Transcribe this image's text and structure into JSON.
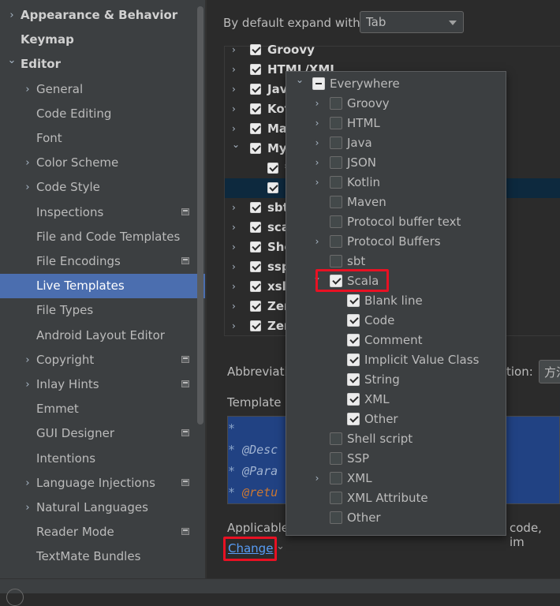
{
  "sidebar": {
    "items": [
      {
        "label": "Appearance & Behavior",
        "level": 0,
        "chevron": "right",
        "bold": true,
        "selected": false,
        "pin": false
      },
      {
        "label": "Keymap",
        "level": 0,
        "chevron": "",
        "bold": true,
        "selected": false,
        "pin": false
      },
      {
        "label": "Editor",
        "level": 0,
        "chevron": "down",
        "bold": true,
        "selected": false,
        "pin": false
      },
      {
        "label": "General",
        "level": 1,
        "chevron": "right",
        "bold": false,
        "selected": false,
        "pin": false
      },
      {
        "label": "Code Editing",
        "level": 1,
        "chevron": "",
        "bold": false,
        "selected": false,
        "pin": false
      },
      {
        "label": "Font",
        "level": 1,
        "chevron": "",
        "bold": false,
        "selected": false,
        "pin": false
      },
      {
        "label": "Color Scheme",
        "level": 1,
        "chevron": "right",
        "bold": false,
        "selected": false,
        "pin": false
      },
      {
        "label": "Code Style",
        "level": 1,
        "chevron": "right",
        "bold": false,
        "selected": false,
        "pin": false
      },
      {
        "label": "Inspections",
        "level": 1,
        "chevron": "",
        "bold": false,
        "selected": false,
        "pin": true
      },
      {
        "label": "File and Code Templates",
        "level": 1,
        "chevron": "",
        "bold": false,
        "selected": false,
        "pin": false
      },
      {
        "label": "File Encodings",
        "level": 1,
        "chevron": "",
        "bold": false,
        "selected": false,
        "pin": true
      },
      {
        "label": "Live Templates",
        "level": 1,
        "chevron": "",
        "bold": false,
        "selected": true,
        "pin": false
      },
      {
        "label": "File Types",
        "level": 1,
        "chevron": "",
        "bold": false,
        "selected": false,
        "pin": false
      },
      {
        "label": "Android Layout Editor",
        "level": 1,
        "chevron": "",
        "bold": false,
        "selected": false,
        "pin": false
      },
      {
        "label": "Copyright",
        "level": 1,
        "chevron": "right",
        "bold": false,
        "selected": false,
        "pin": true
      },
      {
        "label": "Inlay Hints",
        "level": 1,
        "chevron": "right",
        "bold": false,
        "selected": false,
        "pin": true
      },
      {
        "label": "Emmet",
        "level": 1,
        "chevron": "",
        "bold": false,
        "selected": false,
        "pin": false
      },
      {
        "label": "GUI Designer",
        "level": 1,
        "chevron": "",
        "bold": false,
        "selected": false,
        "pin": true
      },
      {
        "label": "Intentions",
        "level": 1,
        "chevron": "",
        "bold": false,
        "selected": false,
        "pin": false
      },
      {
        "label": "Language Injections",
        "level": 1,
        "chevron": "right",
        "bold": false,
        "selected": false,
        "pin": true
      },
      {
        "label": "Natural Languages",
        "level": 1,
        "chevron": "right",
        "bold": false,
        "selected": false,
        "pin": false
      },
      {
        "label": "Reader Mode",
        "level": 1,
        "chevron": "",
        "bold": false,
        "selected": false,
        "pin": true
      },
      {
        "label": "TextMate Bundles",
        "level": 1,
        "chevron": "",
        "bold": false,
        "selected": false,
        "pin": false
      }
    ]
  },
  "main": {
    "expand_label": "By default expand with",
    "expand_value": "Tab",
    "tree_rows": [
      {
        "label": "Groovy",
        "chevron": "right",
        "indent": 0,
        "selected": false
      },
      {
        "label": "HTML/XML",
        "chevron": "right",
        "indent": 0,
        "selected": false
      },
      {
        "label": "Java",
        "chevron": "right",
        "indent": 0,
        "selected": false
      },
      {
        "label": "Kotlin",
        "chevron": "right",
        "indent": 0,
        "selected": false
      },
      {
        "label": "Maven",
        "chevron": "right",
        "indent": 0,
        "selected": false
      },
      {
        "label": "My",
        "chevron": "down",
        "indent": 0,
        "selected": false
      },
      {
        "label": "*",
        "chevron": "",
        "indent": 1,
        "selected": false
      },
      {
        "label": "",
        "chevron": "",
        "indent": 1,
        "selected": true
      },
      {
        "label": "sbt",
        "chevron": "right",
        "indent": 0,
        "selected": false
      },
      {
        "label": "scala",
        "chevron": "right",
        "indent": 0,
        "selected": false
      },
      {
        "label": "Shell",
        "chevron": "right",
        "indent": 0,
        "selected": false
      },
      {
        "label": "ssp",
        "chevron": "right",
        "indent": 0,
        "selected": false
      },
      {
        "label": "xsl",
        "chevron": "right",
        "indent": 0,
        "selected": false
      },
      {
        "label": "Zen",
        "chevron": "right",
        "indent": 0,
        "selected": false
      },
      {
        "label": "Zen",
        "chevron": "right",
        "indent": 0,
        "selected": false
      }
    ],
    "abbrev_label": "Abbreviati",
    "abbrev_right_label": "tion:",
    "abbrev_right_value": "方法",
    "template_label": "Template",
    "code_lines": [
      {
        "prefix": "*",
        "tag": "",
        "rest": ""
      },
      {
        "prefix": " * ",
        "tag": "@Desc",
        "rest": ""
      },
      {
        "prefix": " * ",
        "tag": "@Para",
        "rest": ""
      },
      {
        "prefix": " * ",
        "tag": "@retu",
        "rest": ""
      }
    ],
    "applicable_label": "Applicable",
    "applicable_right": "code, im",
    "change_label": "Change",
    "change_caret": "⌄"
  },
  "popup": {
    "items": [
      {
        "label": "Everywhere",
        "indent": 0,
        "chevron": "down",
        "state": "mixed"
      },
      {
        "label": "Groovy",
        "indent": 1,
        "chevron": "right",
        "state": "off"
      },
      {
        "label": "HTML",
        "indent": 1,
        "chevron": "right",
        "state": "off"
      },
      {
        "label": "Java",
        "indent": 1,
        "chevron": "right",
        "state": "off"
      },
      {
        "label": "JSON",
        "indent": 1,
        "chevron": "right",
        "state": "off"
      },
      {
        "label": "Kotlin",
        "indent": 1,
        "chevron": "right",
        "state": "off"
      },
      {
        "label": "Maven",
        "indent": 1,
        "chevron": "",
        "state": "off"
      },
      {
        "label": "Protocol buffer text",
        "indent": 1,
        "chevron": "",
        "state": "off"
      },
      {
        "label": "Protocol Buffers",
        "indent": 1,
        "chevron": "right",
        "state": "off"
      },
      {
        "label": "sbt",
        "indent": 1,
        "chevron": "",
        "state": "off"
      },
      {
        "label": "Scala",
        "indent": 1,
        "chevron": "down",
        "state": "on"
      },
      {
        "label": "Blank line",
        "indent": 2,
        "chevron": "",
        "state": "on"
      },
      {
        "label": "Code",
        "indent": 2,
        "chevron": "",
        "state": "on"
      },
      {
        "label": "Comment",
        "indent": 2,
        "chevron": "",
        "state": "on"
      },
      {
        "label": "Implicit Value Class",
        "indent": 2,
        "chevron": "",
        "state": "on"
      },
      {
        "label": "String",
        "indent": 2,
        "chevron": "",
        "state": "on"
      },
      {
        "label": "XML",
        "indent": 2,
        "chevron": "",
        "state": "on"
      },
      {
        "label": "Other",
        "indent": 2,
        "chevron": "",
        "state": "on"
      },
      {
        "label": "Shell script",
        "indent": 1,
        "chevron": "",
        "state": "off"
      },
      {
        "label": "SSP",
        "indent": 1,
        "chevron": "",
        "state": "off"
      },
      {
        "label": "XML",
        "indent": 1,
        "chevron": "right",
        "state": "off"
      },
      {
        "label": "XML Attribute",
        "indent": 1,
        "chevron": "",
        "state": "off"
      },
      {
        "label": "Other",
        "indent": 1,
        "chevron": "",
        "state": "off"
      }
    ]
  },
  "colors": {
    "selection": "#4b6eaf",
    "link": "#589df6",
    "highlight_box": "#e81123",
    "code_background": "#214283"
  }
}
